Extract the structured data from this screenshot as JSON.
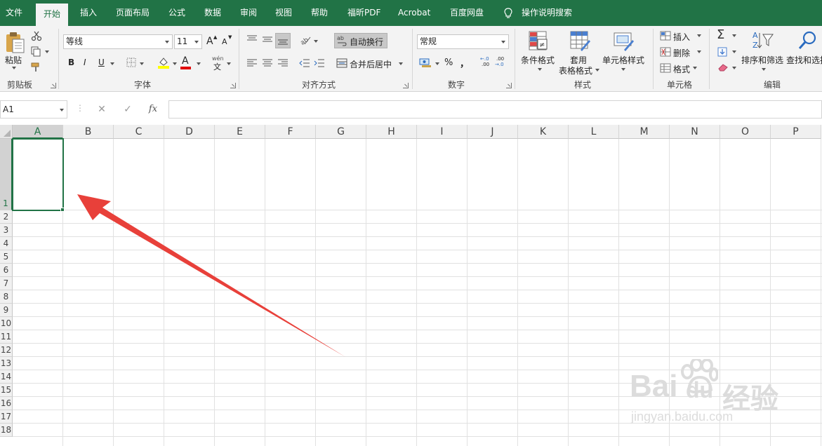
{
  "tabs": [
    {
      "label": "文件"
    },
    {
      "label": "开始"
    },
    {
      "label": "插入"
    },
    {
      "label": "页面布局"
    },
    {
      "label": "公式"
    },
    {
      "label": "数据"
    },
    {
      "label": "审阅"
    },
    {
      "label": "视图"
    },
    {
      "label": "帮助"
    },
    {
      "label": "福昕PDF"
    },
    {
      "label": "Acrobat"
    },
    {
      "label": "百度网盘"
    }
  ],
  "tell_me": "操作说明搜索",
  "clipboard": {
    "paste": "粘贴",
    "group": "剪贴板"
  },
  "font": {
    "name": "等线",
    "size": "11",
    "grow": "A",
    "shrink": "A",
    "bold": "B",
    "italic": "I",
    "underline": "U",
    "color_letter": "A",
    "phonetic_top": "wén",
    "phonetic_bottom": "文",
    "group": "字体"
  },
  "alignment": {
    "wrap": "自动换行",
    "merge": "合并后居中",
    "group": "对齐方式"
  },
  "number": {
    "format": "常规",
    "percent": "%",
    "comma": "，",
    "inc_top": "←.0",
    "inc_bottom": ".00",
    "dec_top": ".00",
    "dec_bottom": "→.0",
    "group": "数字"
  },
  "styles": {
    "conditional": "条件格式",
    "table_top": "套用",
    "table_bottom": "表格格式",
    "cell_styles": "单元格样式",
    "group": "样式"
  },
  "cells": {
    "insert": "插入",
    "delete": "删除",
    "format": "格式",
    "group": "单元格"
  },
  "editing": {
    "sort": "排序和筛选",
    "find": "查找和选择",
    "group": "编辑"
  },
  "formula_bar": {
    "name_box": "A1",
    "cancel": "✕",
    "enter": "✓",
    "fx": "fx",
    "value": ""
  },
  "columns": [
    "A",
    "B",
    "C",
    "D",
    "E",
    "F",
    "G",
    "H",
    "I",
    "J",
    "K",
    "L",
    "M",
    "N",
    "O",
    "P"
  ],
  "rows": [
    "1",
    "2",
    "3",
    "4",
    "5",
    "6",
    "7",
    "8",
    "9",
    "10",
    "11",
    "12",
    "13",
    "14",
    "15",
    "16",
    "17",
    "18"
  ],
  "selected_cell": "A1",
  "annotation_color": "#e8403a",
  "accent_color": "#217346",
  "watermark": {
    "brand": "Bai",
    "brand2": "du",
    "cn": "经验",
    "url": "jingyan.baidu.com"
  }
}
